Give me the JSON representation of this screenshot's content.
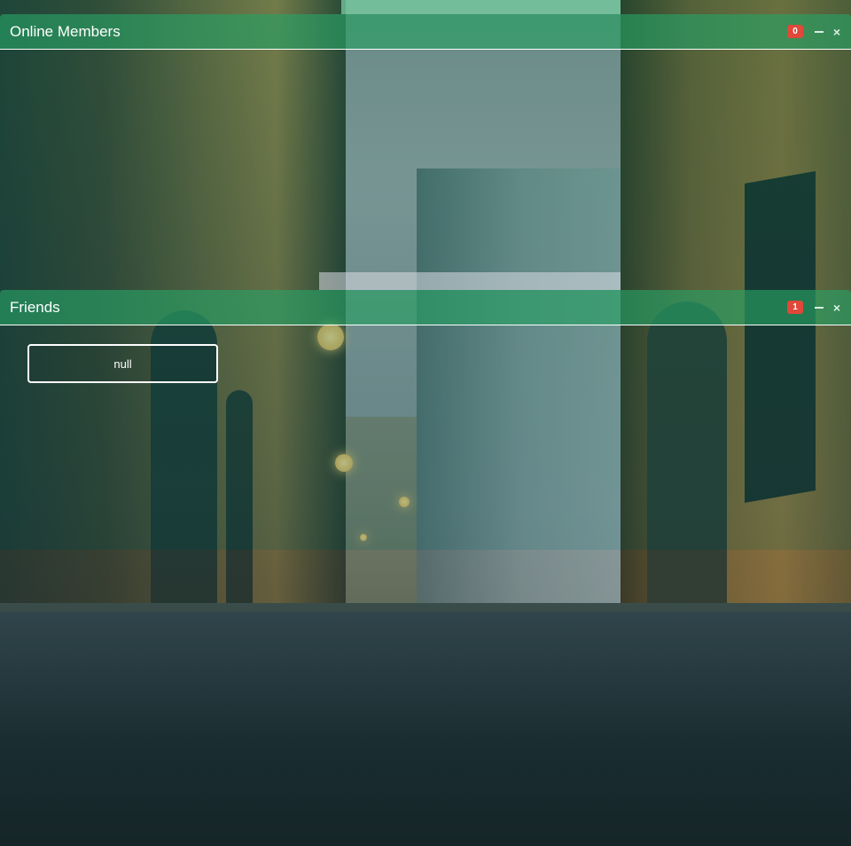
{
  "panels": {
    "online_members": {
      "title": "Online Members",
      "badge": "0",
      "minimize_icon": "minimize-icon",
      "close_icon": "close-icon",
      "close_glyph": "×"
    },
    "friends": {
      "title": "Friends",
      "badge": "1",
      "minimize_icon": "minimize-icon",
      "close_icon": "close-icon",
      "close_glyph": "×",
      "items": [
        {
          "label": "null"
        }
      ]
    }
  },
  "colors": {
    "header_bg": "#28a064",
    "badge_bg": "#e0483a",
    "text": "#ffffff"
  }
}
